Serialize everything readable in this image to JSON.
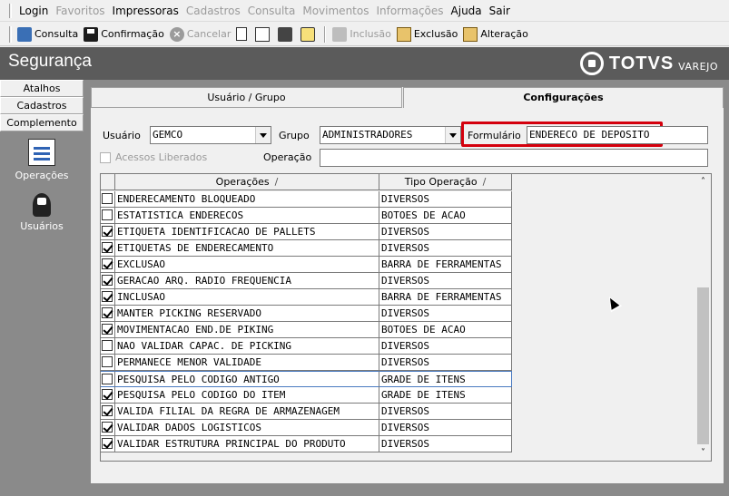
{
  "menu": {
    "items": [
      {
        "label": "Login",
        "enabled": true
      },
      {
        "label": "Favoritos",
        "enabled": false
      },
      {
        "label": "Impressoras",
        "enabled": true
      },
      {
        "label": "Cadastros",
        "enabled": false
      },
      {
        "label": "Consulta",
        "enabled": false
      },
      {
        "label": "Movimentos",
        "enabled": false
      },
      {
        "label": "Informações",
        "enabled": false
      },
      {
        "label": "Ajuda",
        "enabled": true
      },
      {
        "label": "Sair",
        "enabled": true
      }
    ]
  },
  "toolbar": {
    "consulta": "Consulta",
    "confirmacao": "Confirmação",
    "cancelar": "Cancelar",
    "inclusao": "Inclusão",
    "exclusao": "Exclusão",
    "alteracao": "Alteração",
    "cancel_glyph": "×"
  },
  "titlebar": {
    "title": "Segurança",
    "logo_text": "TOTVS",
    "logo_sub": "VAREJO"
  },
  "leftnav": {
    "buttons": [
      "Atalhos",
      "Cadastros",
      "Complemento"
    ],
    "items": [
      "Operações",
      "Usuários"
    ]
  },
  "tabs": {
    "usuario_grupo": "Usuário / Grupo",
    "configuracoes": "Configurações"
  },
  "form": {
    "usuario_label": "Usuário",
    "usuario_value": "GEMCO",
    "grupo_label": "Grupo",
    "grupo_value": "ADMINISTRADORES",
    "formulario_label": "Formulário",
    "formulario_value": "ENDERECO DE DEPOSITO",
    "acessos_label": "Acessos Liberados",
    "operacao_label": "Operação",
    "operacao_value": ""
  },
  "grid": {
    "col_operacoes": "Operações",
    "col_tipo": "Tipo Operação",
    "sort_glyph": "/",
    "rows": [
      {
        "checked": false,
        "operacao": "ENDERECAMENTO BLOQUEADO",
        "tipo": "DIVERSOS"
      },
      {
        "checked": false,
        "operacao": "ESTATISTICA ENDERECOS",
        "tipo": "BOTOES DE ACAO"
      },
      {
        "checked": true,
        "operacao": "ETIQUETA IDENTIFICACAO DE PALLETS",
        "tipo": "DIVERSOS"
      },
      {
        "checked": true,
        "operacao": "ETIQUETAS DE ENDERECAMENTO",
        "tipo": "DIVERSOS"
      },
      {
        "checked": true,
        "operacao": "EXCLUSAO",
        "tipo": "BARRA DE FERRAMENTAS"
      },
      {
        "checked": true,
        "operacao": "GERACAO ARQ. RADIO FREQUENCIA",
        "tipo": "DIVERSOS"
      },
      {
        "checked": true,
        "operacao": "INCLUSAO",
        "tipo": "BARRA DE FERRAMENTAS"
      },
      {
        "checked": true,
        "operacao": "MANTER PICKING RESERVADO",
        "tipo": "DIVERSOS"
      },
      {
        "checked": true,
        "operacao": "MOVIMENTACAO END.DE PIKING",
        "tipo": "BOTOES DE ACAO"
      },
      {
        "checked": false,
        "operacao": "NAO VALIDAR CAPAC. DE PICKING",
        "tipo": "DIVERSOS"
      },
      {
        "checked": false,
        "operacao": "PERMANECE MENOR VALIDADE",
        "tipo": "DIVERSOS"
      },
      {
        "checked": false,
        "operacao": "PESQUISA PELO CODIGO ANTIGO",
        "tipo": "GRADE DE ITENS",
        "focused": true
      },
      {
        "checked": true,
        "operacao": "PESQUISA PELO CODIGO DO ITEM",
        "tipo": "GRADE DE ITENS"
      },
      {
        "checked": true,
        "operacao": "VALIDA FILIAL DA REGRA DE ARMAZENAGEM",
        "tipo": "DIVERSOS"
      },
      {
        "checked": true,
        "operacao": "VALIDAR DADOS LOGISTICOS",
        "tipo": "DIVERSOS"
      },
      {
        "checked": true,
        "operacao": "VALIDAR ESTRUTURA PRINCIPAL DO PRODUTO",
        "tipo": "DIVERSOS"
      }
    ],
    "scroll_up": "˄",
    "scroll_down": "˅"
  },
  "colors": {
    "highlight": "#d4000d",
    "titlebar": "#5b5b5b",
    "panel": "#8a8a8a"
  }
}
